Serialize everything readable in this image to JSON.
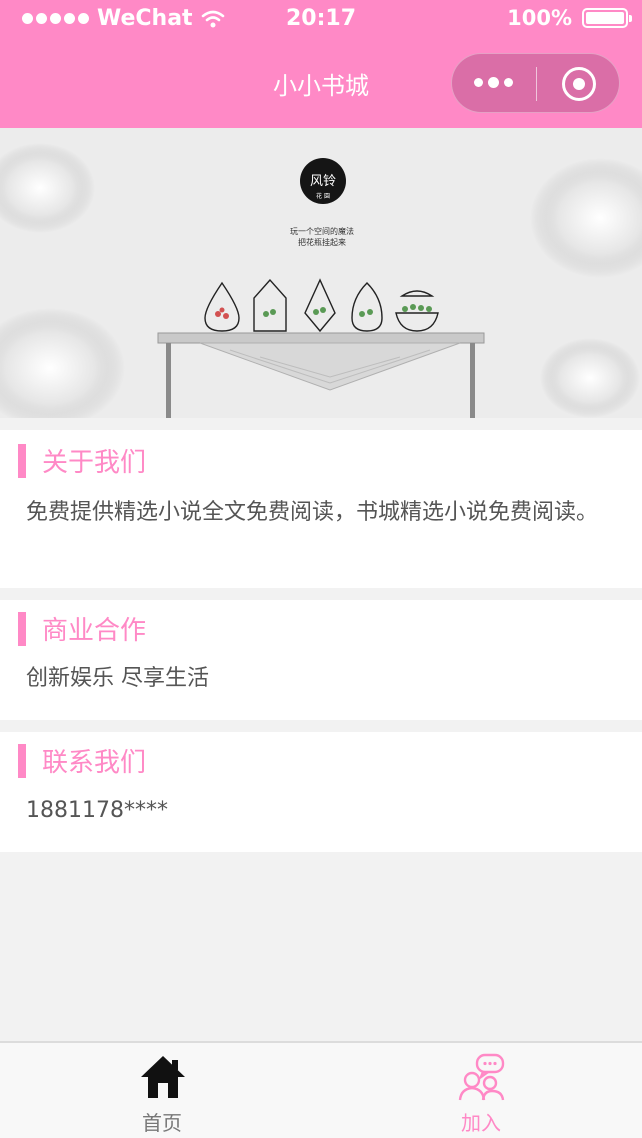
{
  "status_bar": {
    "carrier": "WeChat",
    "time": "20:17",
    "battery": "100%"
  },
  "nav": {
    "title": "小小书城"
  },
  "banner": {
    "logo_text": "风铃",
    "logo_sub": "花 園",
    "tagline_1": "玩一个空间的魔法",
    "tagline_2": "把花瓶挂起来"
  },
  "sections": [
    {
      "title": "关于我们",
      "body": "免费提供精选小说全文免费阅读，书城精选小说免费阅读。"
    },
    {
      "title": "商业合作",
      "body": "创新娱乐 尽享生活"
    },
    {
      "title": "联系我们",
      "body": "1881178****"
    }
  ],
  "tabbar": {
    "items": [
      {
        "label": "首页",
        "icon": "home-icon",
        "active": false
      },
      {
        "label": "加入",
        "icon": "users-chat-icon",
        "active": true
      }
    ]
  },
  "colors": {
    "accent": "#ff89c6",
    "tab_inactive": "#777777",
    "body_text": "#555555",
    "page_bg": "#f2f2f2"
  }
}
